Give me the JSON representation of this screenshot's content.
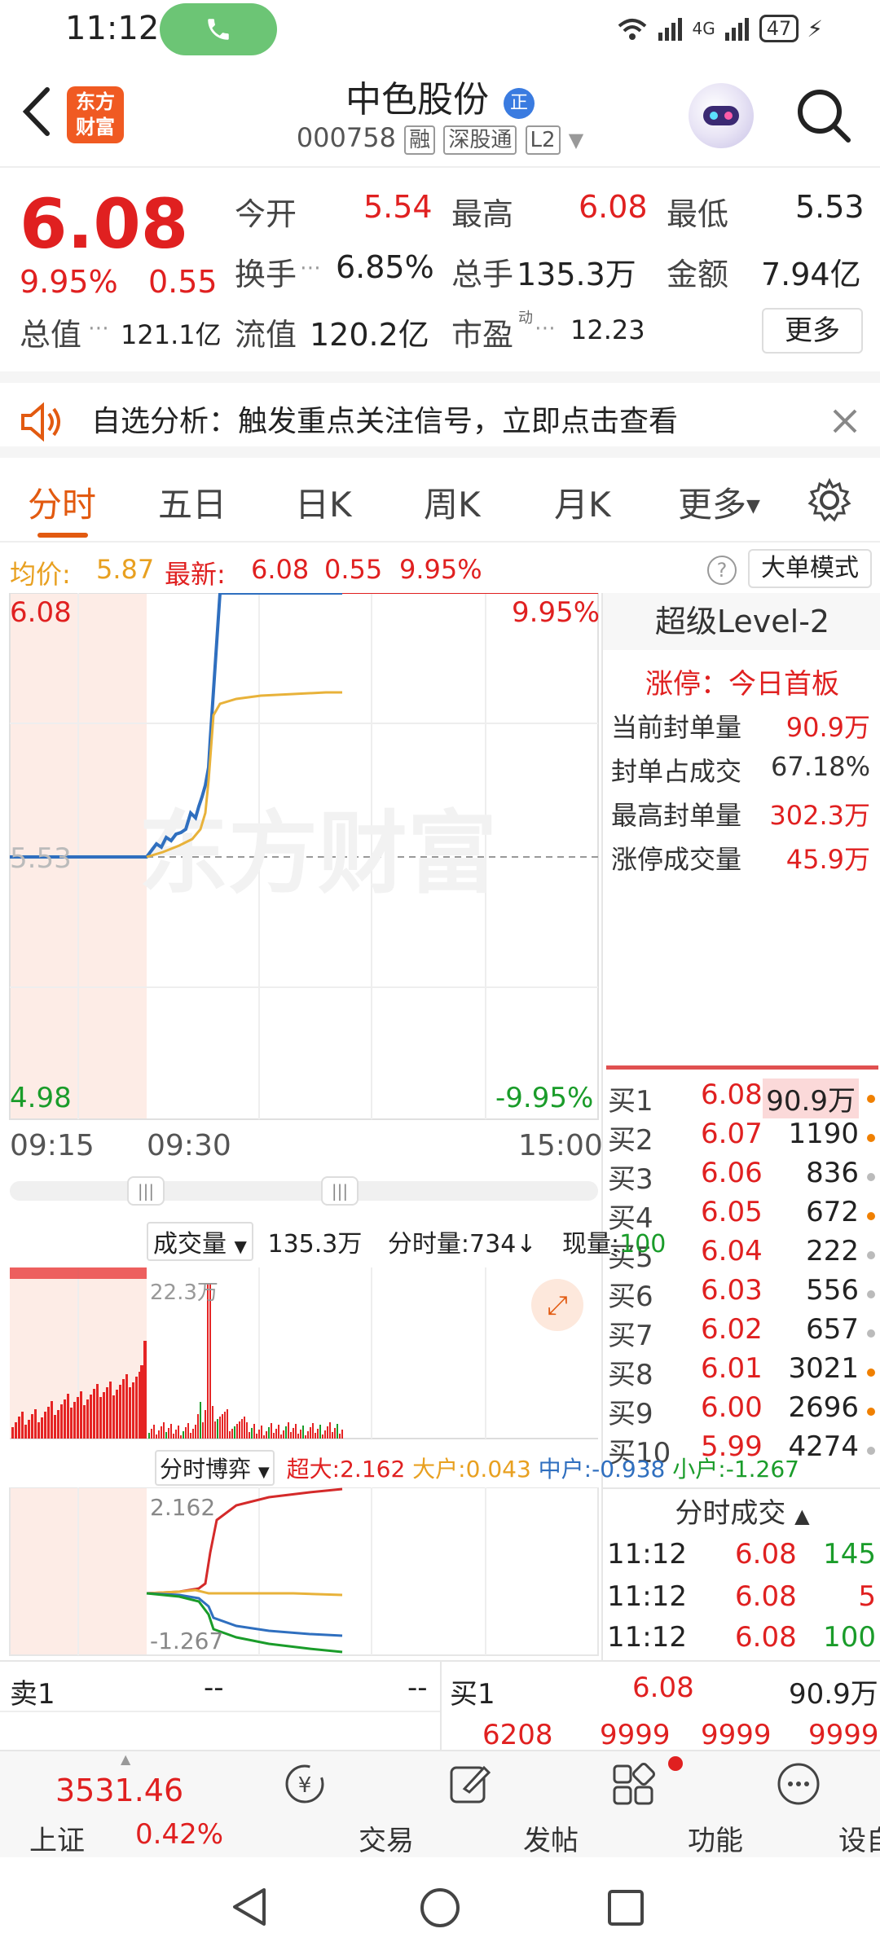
{
  "status": {
    "time": "11:12",
    "battery": "47",
    "network": "4G"
  },
  "header": {
    "logo": "东方\n财富",
    "name": "中色股份",
    "name_badge": "正",
    "code": "000758",
    "tags": [
      "融",
      "深股通",
      "L2"
    ]
  },
  "quote": {
    "price": "6.08",
    "pct": "9.95%",
    "change": "0.55",
    "open_label": "今开",
    "open": "5.54",
    "high_label": "最高",
    "high": "6.08",
    "low_label": "最低",
    "low": "5.53",
    "turnover_label": "换手",
    "turnover": "6.85%",
    "vol_label": "总手",
    "vol": "135.3万",
    "amount_label": "金额",
    "amount": "7.94亿",
    "mcap_label": "总值",
    "mcap": "121.1亿",
    "float_label": "流值",
    "float": "120.2亿",
    "pe_label": "市盈",
    "pe_sup": "动",
    "pe": "12.23",
    "more": "更多"
  },
  "notice": {
    "text": "自选分析：触发重点关注信号，立即点击查看"
  },
  "tabs": [
    "分时",
    "五日",
    "日K",
    "周K",
    "月K",
    "更多"
  ],
  "infobar": {
    "avg_label": "均价:",
    "avg": "5.87",
    "latest_label": "最新:",
    "latest": "6.08",
    "chg": "0.55",
    "pct": "9.95%",
    "bigmode": "大单模式"
  },
  "chart": {
    "top_price": "6.08",
    "top_pct": "9.95%",
    "mid_price": "5.53",
    "bottom_price": "4.98",
    "bottom_pct": "-9.95%",
    "watermark": "东方财富",
    "times": [
      "09:15",
      "09:30",
      "15:00"
    ]
  },
  "l2": {
    "title": "超级Level-2",
    "limit_label": "涨停：今日首板",
    "rows": [
      {
        "label": "当前封单量",
        "value": "90.9万"
      },
      {
        "label": "封单占成交",
        "value": "67.18%"
      },
      {
        "label": "最高封单量",
        "value": "302.3万"
      },
      {
        "label": "涨停成交量",
        "value": "45.9万"
      }
    ],
    "bids": [
      {
        "label": "买1",
        "price": "6.08",
        "vol": "90.9万",
        "dot": "#f08000"
      },
      {
        "label": "买2",
        "price": "6.07",
        "vol": "1190",
        "dot": "#f08000"
      },
      {
        "label": "买3",
        "price": "6.06",
        "vol": "836",
        "dot": "#bbbbbb"
      },
      {
        "label": "买4",
        "price": "6.05",
        "vol": "672",
        "dot": "#f08000"
      },
      {
        "label": "买5",
        "price": "6.04",
        "vol": "222",
        "dot": "#bbbbbb"
      },
      {
        "label": "买6",
        "price": "6.03",
        "vol": "556",
        "dot": "#bbbbbb"
      },
      {
        "label": "买7",
        "price": "6.02",
        "vol": "657",
        "dot": "#bbbbbb"
      },
      {
        "label": "买8",
        "price": "6.01",
        "vol": "3021",
        "dot": "#f08000"
      },
      {
        "label": "买9",
        "price": "6.00",
        "vol": "2696",
        "dot": "#f08000"
      },
      {
        "label": "买10",
        "price": "5.99",
        "vol": "4274",
        "dot": "#bbbbbb"
      }
    ],
    "trades_title": "分时成交",
    "trades": [
      {
        "time": "11:12",
        "price": "6.08",
        "vol": "145"
      },
      {
        "time": "11:12",
        "price": "6.08",
        "vol": "5"
      },
      {
        "time": "11:12",
        "price": "6.08",
        "vol": "100"
      }
    ]
  },
  "volume": {
    "selector": "成交量",
    "total": "135.3万",
    "minute_label": "分时量:734↓",
    "now_label": "现量:",
    "now": "100",
    "max": "22.3万"
  },
  "game": {
    "selector": "分时博弈",
    "super_label": "超大:2.162",
    "big_label": "大户:0.043",
    "mid_label": "中户:-0.938",
    "small_label": "小户:-1.267",
    "top": "2.162",
    "bottom": "-1.267"
  },
  "bidask": {
    "ask_label": "卖1",
    "ask_price": "--",
    "ask_vol": "--",
    "bid_label": "买1",
    "bid_price": "6.08",
    "bid_vol": "90.9万",
    "row2": [
      "6208",
      "9999",
      "9999",
      "9999"
    ]
  },
  "bottomnav": {
    "index_value": "3531.46",
    "index_name": "上证",
    "index_pct": "0.42%",
    "items": [
      "交易",
      "发帖",
      "功能",
      "设自选"
    ]
  },
  "colors": {
    "up": "#e02020",
    "down": "#1a9c2a",
    "accent": "#e25a10",
    "price_line": "#2f6fbf",
    "avg_line": "#e8b23a"
  }
}
